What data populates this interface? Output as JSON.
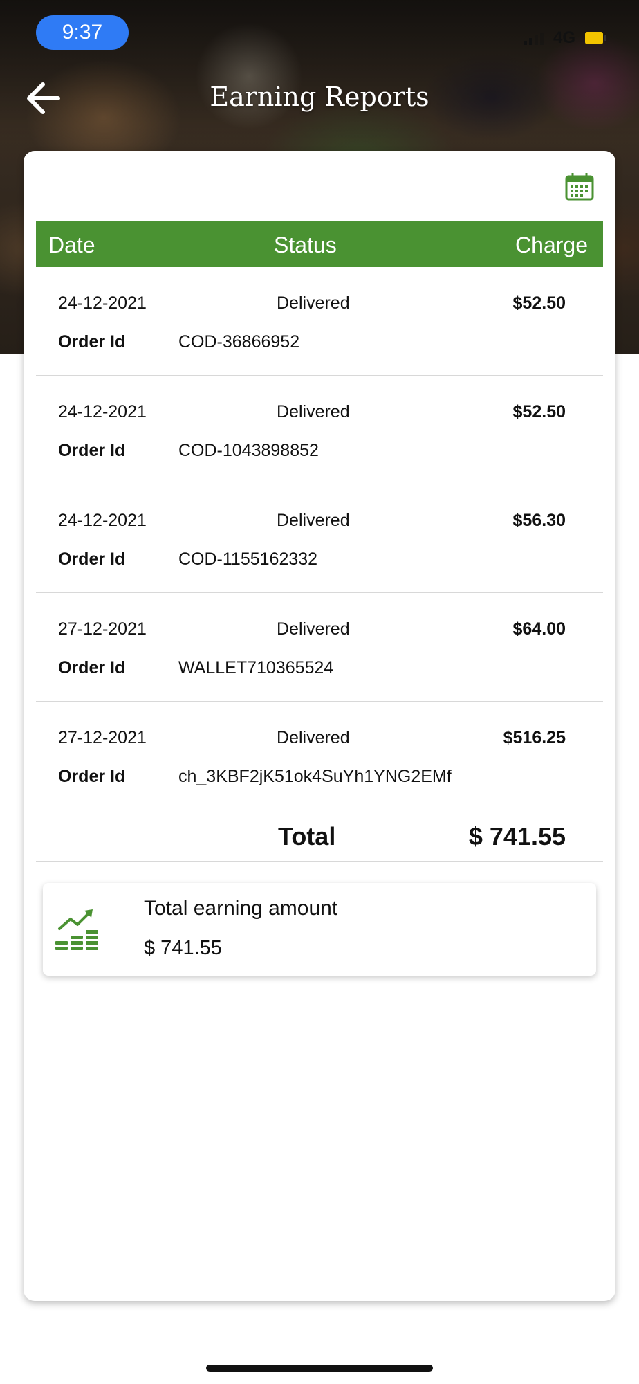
{
  "status_bar": {
    "time": "9:37",
    "network": "4G"
  },
  "header": {
    "title": "Earning Reports",
    "back_icon": "arrow-left-icon"
  },
  "toolbar": {
    "calendar_icon": "calendar-icon"
  },
  "table": {
    "headers": {
      "date": "Date",
      "status": "Status",
      "charge": "Charge"
    },
    "order_id_label": "Order Id",
    "rows": [
      {
        "date": "24-12-2021",
        "status": "Delivered",
        "charge": "$52.50",
        "order_id": "COD-36866952"
      },
      {
        "date": "24-12-2021",
        "status": "Delivered",
        "charge": "$52.50",
        "order_id": "COD-1043898852"
      },
      {
        "date": "24-12-2021",
        "status": "Delivered",
        "charge": "$56.30",
        "order_id": "COD-1155162332"
      },
      {
        "date": "27-12-2021",
        "status": "Delivered",
        "charge": "$64.00",
        "order_id": "WALLET710365524"
      },
      {
        "date": "27-12-2021",
        "status": "Delivered",
        "charge": "$516.25",
        "order_id": "ch_3KBF2jK51ok4SuYh1YNG2EMf"
      }
    ],
    "total_label": "Total",
    "total_value": "$ 741.55"
  },
  "summary": {
    "label": "Total earning amount",
    "value": "$ 741.55",
    "icon": "earnings-chart-icon"
  },
  "colors": {
    "accent_green": "#4a9232",
    "time_pill": "#2f7bf5"
  }
}
